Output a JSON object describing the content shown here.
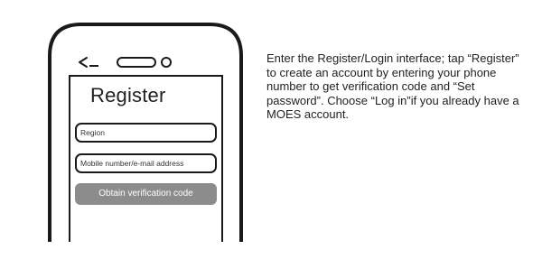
{
  "phone": {
    "screen_title": "Register",
    "region_field": "Region",
    "mobile_field": "Mobile number/e-mail address",
    "verify_button": "Obtain verification code",
    "back_icon": "back-arrow-icon",
    "speaker_icon": "speaker-slot-icon",
    "camera_icon": "camera-dot-icon"
  },
  "instruction": {
    "text": "Enter the Register/Login interface; tap “Register” to create an account by entering your phone number to get verification code and “Set password”. Choose “Log in”if you already have a MOES account."
  }
}
